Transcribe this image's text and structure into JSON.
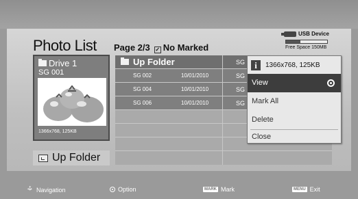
{
  "header": {
    "title": "Photo List",
    "page_label": "Page 2/3",
    "mark_status": "No Marked"
  },
  "usb": {
    "label": "USB Device",
    "free_space": "Free Space 150MB",
    "usage_fraction": 0.35
  },
  "drive": {
    "name": "Drive 1",
    "selected_file": "SG 001",
    "resolution": "1366x768, 125KB"
  },
  "up_folder_button": {
    "label": "Up Folder"
  },
  "file_list": {
    "up_folder_label": "Up Folder",
    "up_folder_right_partial": "SG",
    "rows": [
      {
        "name": "SG 002",
        "date": "10/01/2010",
        "next": "SG"
      },
      {
        "name": "SG 004",
        "date": "10/01/2010",
        "next": "SG"
      },
      {
        "name": "SG 006",
        "date": "10/01/2010",
        "next": "SG"
      }
    ]
  },
  "option_menu": {
    "info_text": "1366x768, 125KB",
    "items": [
      {
        "label": "View",
        "selected": true
      },
      {
        "label": "Mark All",
        "selected": false
      },
      {
        "label": "Delete",
        "selected": false
      }
    ],
    "close_label": "Close"
  },
  "footer": {
    "navigation": "Navigation",
    "option": "Option",
    "mark_key": "MARK",
    "mark": "Mark",
    "menu_key": "MENU",
    "exit": "Exit"
  },
  "colors": {
    "background": "#9a9a9a",
    "panel": "#cfcfcf",
    "selected_item": "#3d3d3d",
    "tomato": "#b0b0b0"
  }
}
